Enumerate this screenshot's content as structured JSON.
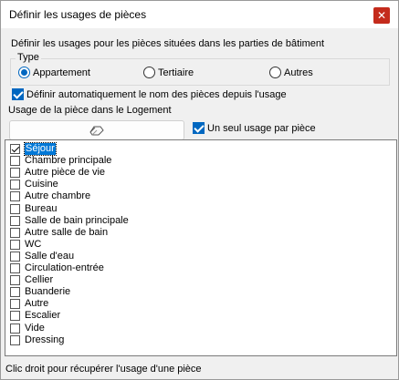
{
  "window": {
    "title": "Définir les usages de pièces",
    "close_glyph": "✕"
  },
  "intro": "Définir les usages pour les pièces situées dans les parties de bâtiment",
  "type_group": {
    "legend": "Type",
    "options": [
      {
        "label": "Appartement",
        "checked": true
      },
      {
        "label": "Tertiaire",
        "checked": false
      },
      {
        "label": "Autres",
        "checked": false
      }
    ]
  },
  "auto_name": {
    "label": "Définir automatiquement  le nom des pièces depuis l'usage",
    "checked": true
  },
  "usage_label": "Usage de la pièce dans le Logement",
  "eraser_icon": "eraser-icon",
  "single_usage": {
    "label": "Un seul usage par pièce",
    "checked": true
  },
  "list": {
    "items": [
      {
        "label": "Séjour",
        "checked": true,
        "selected": true
      },
      {
        "label": "Chambre principale",
        "checked": false,
        "selected": false
      },
      {
        "label": "Autre pièce de vie",
        "checked": false,
        "selected": false
      },
      {
        "label": "Cuisine",
        "checked": false,
        "selected": false
      },
      {
        "label": "Autre chambre",
        "checked": false,
        "selected": false
      },
      {
        "label": "Bureau",
        "checked": false,
        "selected": false
      },
      {
        "label": "Salle de bain principale",
        "checked": false,
        "selected": false
      },
      {
        "label": "Autre salle de bain",
        "checked": false,
        "selected": false
      },
      {
        "label": "WC",
        "checked": false,
        "selected": false
      },
      {
        "label": "Salle d'eau",
        "checked": false,
        "selected": false
      },
      {
        "label": "Circulation-entrée",
        "checked": false,
        "selected": false
      },
      {
        "label": "Cellier",
        "checked": false,
        "selected": false
      },
      {
        "label": "Buanderie",
        "checked": false,
        "selected": false
      },
      {
        "label": "Autre",
        "checked": false,
        "selected": false
      },
      {
        "label": "Escalier",
        "checked": false,
        "selected": false
      },
      {
        "label": "Vide",
        "checked": false,
        "selected": false
      },
      {
        "label": "Dressing",
        "checked": false,
        "selected": false
      }
    ]
  },
  "status": "Clic droit pour récupérer l'usage d'une pièce"
}
